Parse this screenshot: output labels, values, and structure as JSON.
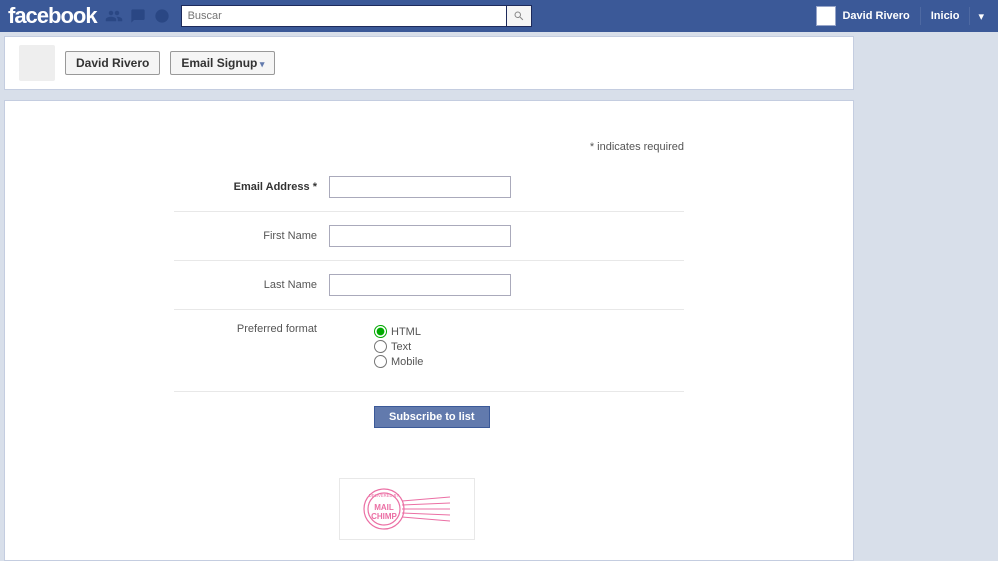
{
  "topbar": {
    "logo": "facebook",
    "search_placeholder": "Buscar",
    "user_name": "David Rivero",
    "home_label": "Inicio"
  },
  "page_header": {
    "crumb_user": "David Rivero",
    "crumb_tab": "Email Signup"
  },
  "form": {
    "required_note": "* indicates required",
    "email_label": "Email Address *",
    "first_name_label": "First Name",
    "last_name_label": "Last Name",
    "format_label": "Preferred format",
    "format_options": {
      "html": "HTML",
      "text": "Text",
      "mobile": "Mobile"
    },
    "selected_format": "html",
    "submit_label": "Subscribe to list"
  },
  "badge": {
    "delivered_by": "DELIVERED BY",
    "mail": "MAIL",
    "chimp": "CHIMP"
  }
}
